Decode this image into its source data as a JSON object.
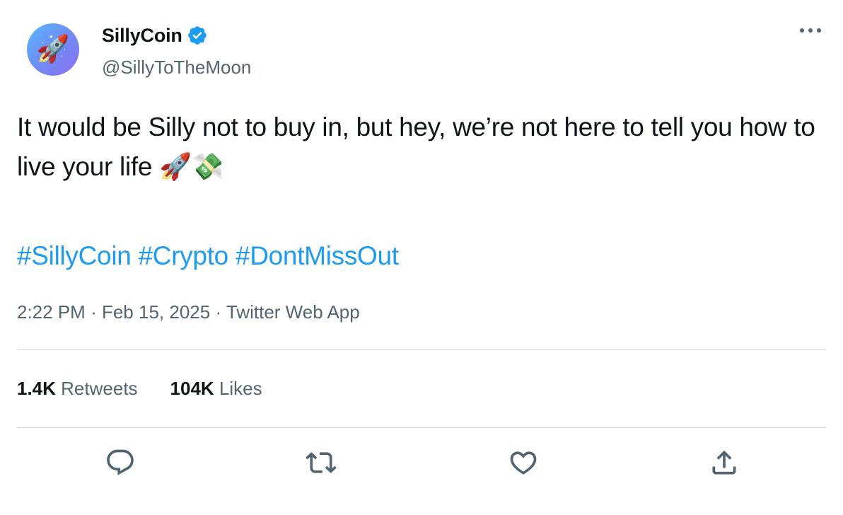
{
  "author": {
    "display_name": "SillyCoin",
    "handle": "@SillyToTheMoon",
    "avatar_emoji": "🚀",
    "verified": true
  },
  "tweet": {
    "text": "It would be Silly not to buy in, but hey, we’re not here to tell you how to live your life 🚀💸",
    "hashtags": [
      "#SillyCoin",
      "#Crypto",
      "#DontMissOut"
    ]
  },
  "meta": {
    "time": "2:22 PM",
    "separator": "·",
    "date": "Feb 15, 2025",
    "source": "Twitter Web App"
  },
  "stats": {
    "retweets_count": "1.4K",
    "retweets_label": "Retweets",
    "likes_count": "104K",
    "likes_label": "Likes"
  },
  "actions": {
    "icons": [
      "reply-icon",
      "retweet-icon",
      "like-icon",
      "share-icon"
    ]
  },
  "colors": {
    "accent": "#1d9bf0",
    "text_primary": "#0f1419",
    "text_secondary": "#536471",
    "divider": "#cfd9de"
  }
}
